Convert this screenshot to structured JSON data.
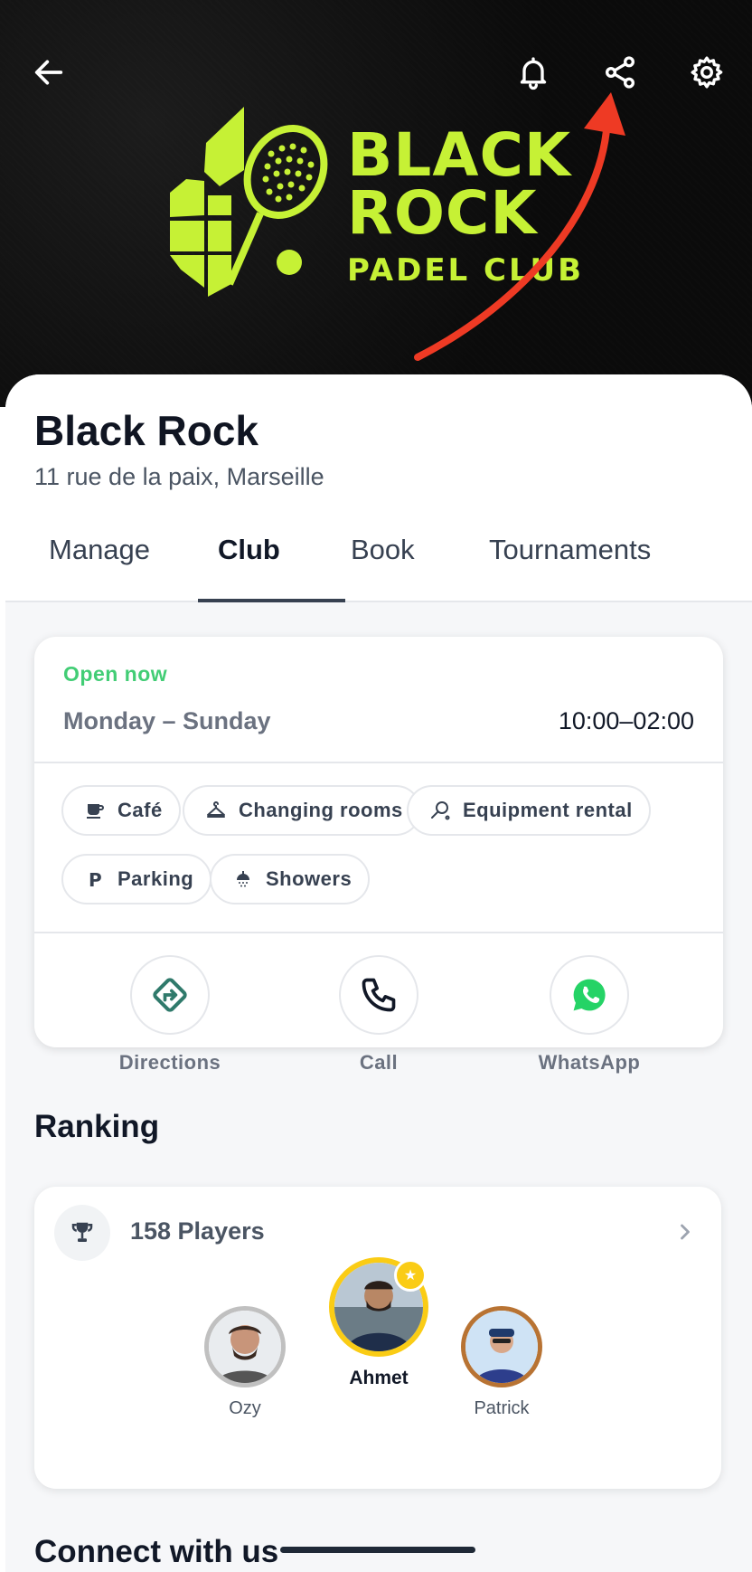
{
  "header": {
    "logo": {
      "line1": "BLACK",
      "line2": "ROCK",
      "line3": "PADEL CLUB"
    },
    "icons": [
      "back-arrow-icon",
      "bell-icon",
      "share-icon",
      "gear-icon"
    ],
    "annotation_color": "#ee3a24"
  },
  "club": {
    "name": "Black Rock",
    "address": "11 rue de la paix, Marseille"
  },
  "tabs": [
    {
      "label": "Manage"
    },
    {
      "label": "Club"
    },
    {
      "label": "Book"
    },
    {
      "label": "Tournaments"
    }
  ],
  "hours": {
    "status": "Open now",
    "days": "Monday – Sunday",
    "time": "10:00–02:00",
    "status_color": "#22c55e"
  },
  "amenities": [
    {
      "label": "Café",
      "icon": "cup-icon"
    },
    {
      "label": "Changing rooms",
      "icon": "hanger-icon"
    },
    {
      "label": "Equipment rental",
      "icon": "racket-icon"
    },
    {
      "label": "Parking",
      "icon": "parking-icon"
    },
    {
      "label": "Showers",
      "icon": "shower-icon"
    }
  ],
  "actions": [
    {
      "label": "Directions",
      "icon": "directions-icon"
    },
    {
      "label": "Call",
      "icon": "phone-icon"
    },
    {
      "label": "WhatsApp",
      "icon": "whatsapp-icon"
    }
  ],
  "ranking": {
    "title": "Ranking",
    "players": "158 Players",
    "podium": [
      {
        "name": "Ozy",
        "rank": 2
      },
      {
        "name": "Ahmet",
        "rank": 1
      },
      {
        "name": "Patrick",
        "rank": 3
      }
    ]
  },
  "connect": {
    "title": "Connect with us"
  }
}
